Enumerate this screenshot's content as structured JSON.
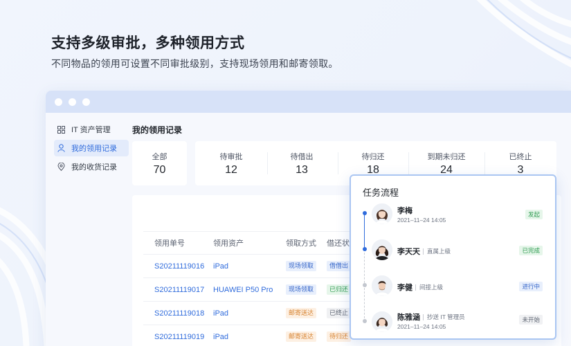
{
  "headline": "支持多级审批，多种领用方式",
  "subline": "不同物品的领用可设置不同审批级别，支持现场领用和邮寄领取。",
  "sidebar": {
    "items": [
      {
        "label": "IT 资产管理",
        "icon": "grid-icon"
      },
      {
        "label": "我的领用记录",
        "icon": "user-icon"
      },
      {
        "label": "我的收货记录",
        "icon": "location-pin-icon"
      }
    ]
  },
  "content_title": "我的领用记录",
  "stats": [
    {
      "label": "全部",
      "value": "70"
    },
    {
      "label": "待审批",
      "value": "12"
    },
    {
      "label": "待借出",
      "value": "13"
    },
    {
      "label": "待归还",
      "value": "18"
    },
    {
      "label": "到期未归还",
      "value": "24"
    },
    {
      "label": "已终止",
      "value": "3"
    }
  ],
  "table": {
    "columns": [
      "领用单号",
      "领用资产",
      "领取方式",
      "借还状态"
    ],
    "rows": [
      {
        "id": "S20211119016",
        "asset": "iPad",
        "method": "现场领取",
        "status": "借借出"
      },
      {
        "id": "S20211119017",
        "asset": "HUAWEI P50 Pro",
        "method": "现场领取",
        "status": "已归还"
      },
      {
        "id": "S20211119018",
        "asset": "iPad",
        "method": "邮寄送达",
        "status": "已终止"
      },
      {
        "id": "S20211119019",
        "asset": "iPad",
        "method": "邮寄送达",
        "status": "待归还"
      }
    ]
  },
  "flow": {
    "title": "任务流程",
    "steps": [
      {
        "name": "李梅",
        "role": "",
        "time": "2021–11–24 14:05",
        "status": "发起"
      },
      {
        "name": "李天天",
        "role": "直属上级",
        "time": "",
        "status": "已完成"
      },
      {
        "name": "李健",
        "role": "间接上级",
        "time": "",
        "status": "进行中"
      },
      {
        "name": "陈雅涵",
        "role": "抄送 IT 管理员",
        "time": "2021–11–24 14:05",
        "status": "未开始"
      }
    ]
  },
  "colors": {
    "accent": "#2f6bdc",
    "titlebar": "#d7e2f8",
    "tag_green": "#2f9b51",
    "tag_orange": "#d7822f",
    "popup_border": "#a9c5f2"
  }
}
